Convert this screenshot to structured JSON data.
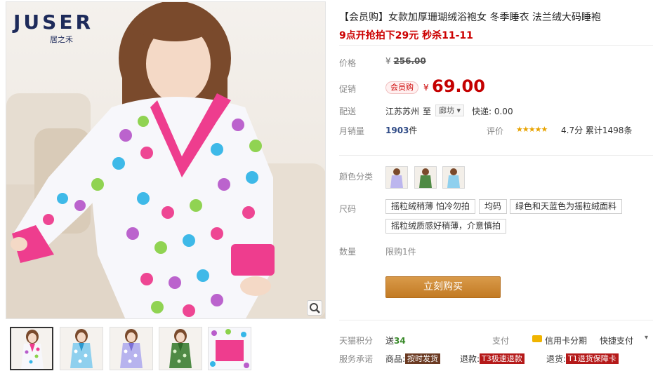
{
  "gallery": {
    "logo_text": "JUSER",
    "logo_sub": "居之禾",
    "thumbnails": [
      {
        "name": "pink-polka-dot-robe"
      },
      {
        "name": "blue-polka-dot-robe"
      },
      {
        "name": "purple-polka-dot-robe"
      },
      {
        "name": "green-polka-dot-robe"
      },
      {
        "name": "fabric-closeup"
      }
    ]
  },
  "product": {
    "title": "【会员购】女款加厚珊瑚绒浴袍女 冬季睡衣 法兰绒大码睡袍",
    "promo": "9点开抢拍下29元 秒杀11-11",
    "price_label": "价格",
    "original_price_prefix": "¥ ",
    "original_price": "256.00",
    "promo_label": "促销",
    "vip_badge": "会员购",
    "currency": "¥",
    "sale_price": "69.00",
    "delivery_label": "配送",
    "from_city": "江苏苏州",
    "to_word": "至",
    "to_city": "廊坊",
    "shipping": "快递: 0.00",
    "sales_label": "月销量",
    "sales_count": "1903",
    "sales_unit": "件",
    "review_label": "评价",
    "stars": "★★★★★",
    "rating_text": "4.7分  累计1498条"
  },
  "options": {
    "color_label": "颜色分类",
    "colors": [
      {
        "name": "lilac"
      },
      {
        "name": "green"
      },
      {
        "name": "blue"
      }
    ],
    "size_label": "尺码",
    "sizes": [
      "摇粒绒稍薄 怕冷勿拍",
      "均码",
      "绿色和天蓝色为摇粒绒面料",
      "摇粒绒质感好稍薄，介意慎拍"
    ],
    "quantity_label": "数量",
    "limit_text": "限购1件",
    "buy_button": "立刻购买"
  },
  "footer": {
    "points_label": "天猫积分",
    "points_prefix": "送",
    "points_value": "34",
    "pay_label": "支付",
    "credit_installment": "信用卡分期",
    "quick_pay": "快捷支付",
    "service_label": "服务承诺",
    "svc1_prefix": "商品:",
    "svc1_tag": "按时发货",
    "svc2_prefix": "退款:",
    "svc2_tag": "T3极速退款",
    "svc3_prefix": "退货:",
    "svc3_tag": "T1退货保障卡"
  },
  "colors": {
    "accent_red": "#c40000",
    "buy_button": "#c98530"
  }
}
